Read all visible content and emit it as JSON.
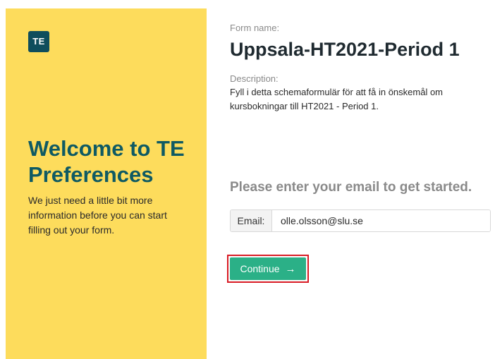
{
  "welcome_panel": {
    "logo_text": "TE",
    "heading": "Welcome to TE Preferences",
    "intro": "We just need a little bit more information before you can start filling out your form.",
    "background_color": "#fddc5c",
    "heading_color": "#0f5a63"
  },
  "form": {
    "name_label": "Form name:",
    "name": "Uppsala-HT2021-Period 1",
    "description_label": "Description:",
    "description": "Fyll i detta schemaformulär för att få in önskemål om kursbokningar till HT2021 - Period 1."
  },
  "login": {
    "prompt": "Please enter your email to get started.",
    "email_label": "Email:",
    "email_value": "olle.olsson@slu.se",
    "continue_label": "Continue",
    "continue_icon": "arrow-right-icon",
    "button_color": "#2bb087",
    "highlight_color": "#d81b24"
  }
}
